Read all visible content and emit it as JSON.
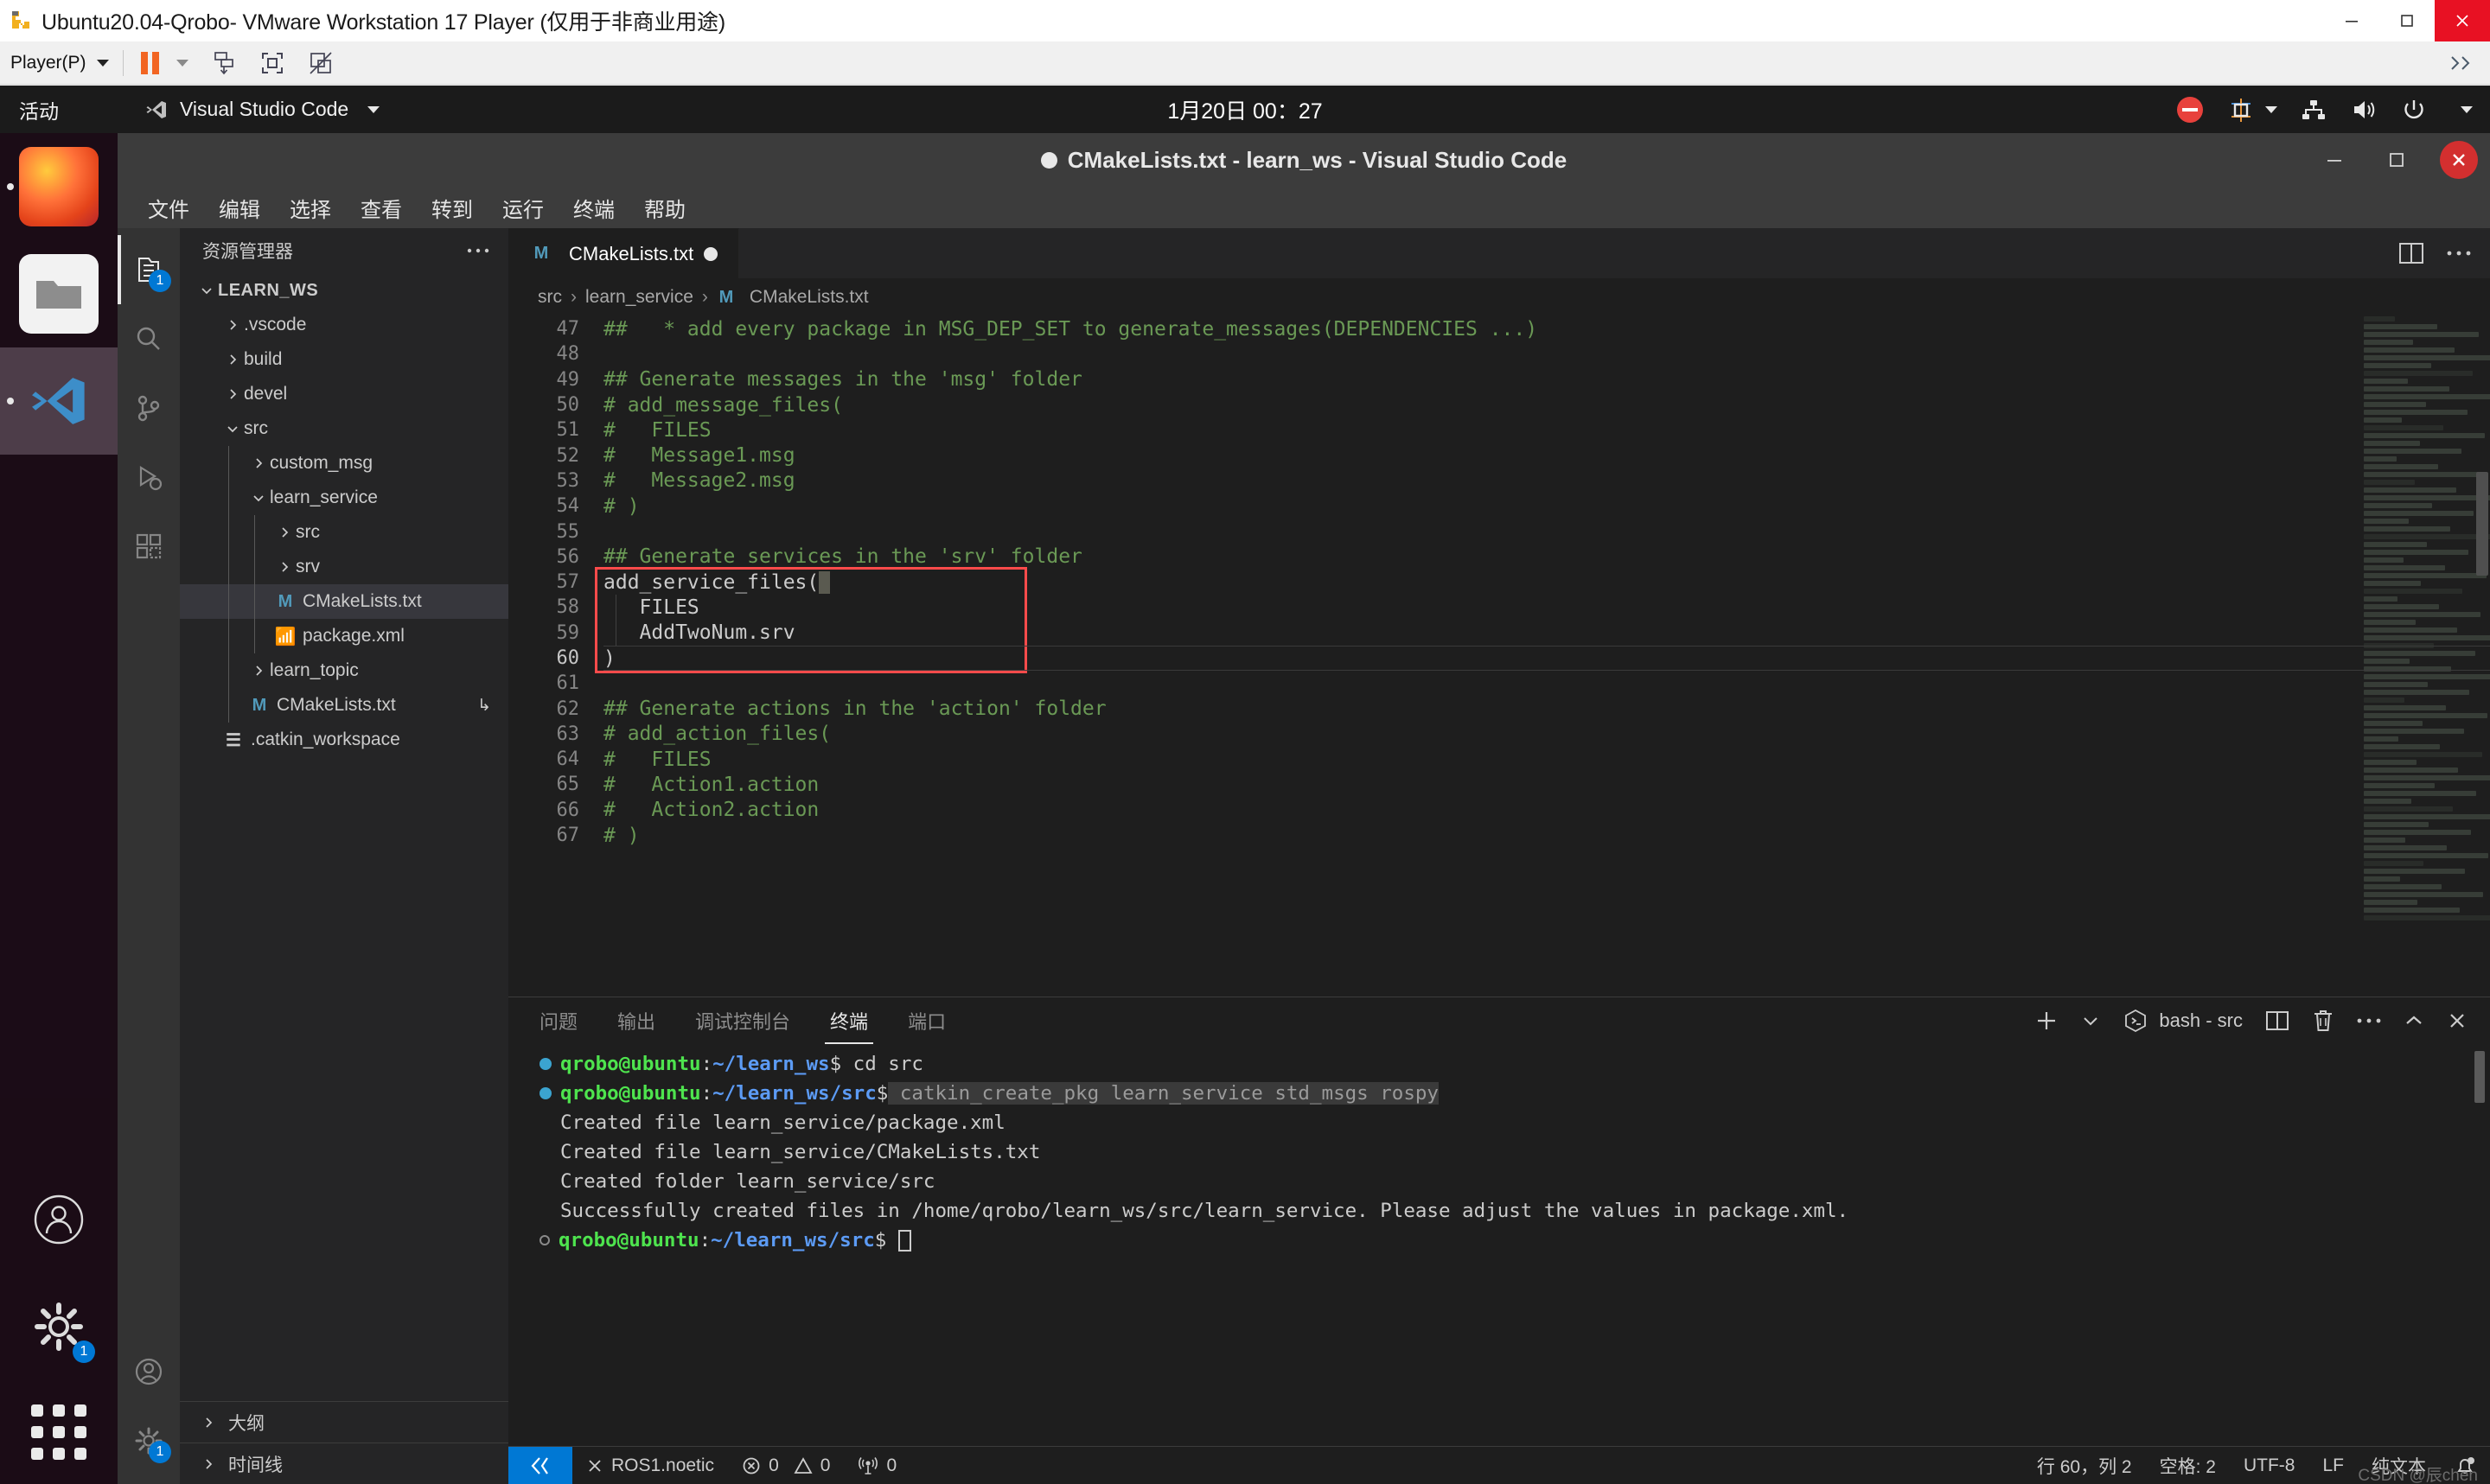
{
  "vmware": {
    "title": "Ubuntu20.04-Qrobo- VMware Workstation 17 Player (仅用于非商业用途)",
    "logo_icon": "vmware-logo-icon",
    "window_controls": [
      {
        "name": "minimize-button",
        "icon": "minimize-icon"
      },
      {
        "name": "restore-button",
        "icon": "restore-icon"
      },
      {
        "name": "close-button",
        "icon": "close-icon"
      }
    ],
    "toolbar": {
      "player_menu_label": "Player(P)",
      "player_menu_accesskey": "P",
      "buttons": [
        {
          "name": "pause-button",
          "icon": "pause-icon"
        },
        {
          "name": "pause-dropdown",
          "icon": "chevron-down-icon"
        },
        {
          "name": "send-ctrl-alt-del-button",
          "icon": "send-key-icon"
        },
        {
          "name": "fullscreen-button",
          "icon": "fullscreen-icon"
        },
        {
          "name": "unity-mode-button",
          "icon": "unity-disabled-icon"
        }
      ],
      "expand_icon": "chevrons-collapse-icon"
    }
  },
  "gnome": {
    "activities_label": "活动",
    "app_menu_label": "Visual Studio Code",
    "app_menu_icon": "vscode-icon",
    "clock": "1月20日 00：27",
    "tray": [
      {
        "name": "do-not-disturb-icon",
        "icon": "no-entry-icon",
        "color": "#e8413c"
      },
      {
        "name": "input-method-icon",
        "label": "中"
      },
      {
        "name": "input-method-chevron-icon",
        "icon": "chevron-down-icon"
      },
      {
        "name": "network-icon",
        "icon": "network-icon"
      },
      {
        "name": "volume-icon",
        "icon": "speaker-icon"
      },
      {
        "name": "power-icon",
        "icon": "power-icon"
      },
      {
        "name": "system-menu-chevron-icon",
        "icon": "chevron-down-icon"
      }
    ],
    "dock": [
      {
        "name": "dock-item-firefox",
        "icon": "firefox-icon",
        "running": true
      },
      {
        "name": "dock-item-files",
        "icon": "files-icon",
        "running": false
      },
      {
        "name": "dock-item-vscode",
        "icon": "vscode-icon",
        "running": true,
        "active": true
      },
      {
        "name": "dock-item-user",
        "icon": "user-account-icon",
        "running": false
      },
      {
        "name": "dock-item-settings",
        "icon": "gear-icon",
        "running": false,
        "badge": "1"
      }
    ],
    "show_apps_label": "show-applications"
  },
  "vscode": {
    "title": "CMakeLists.txt - learn_ws - Visual Studio Code",
    "dirty": true,
    "window_controls": [
      {
        "name": "minimize-button",
        "icon": "minimize-icon"
      },
      {
        "name": "maximize-button",
        "icon": "maximize-icon"
      },
      {
        "name": "close-button",
        "icon": "close-icon"
      }
    ],
    "menubar": [
      "文件",
      "编辑",
      "选择",
      "查看",
      "转到",
      "运行",
      "终端",
      "帮助"
    ],
    "activitybar": [
      {
        "name": "activity-explorer",
        "icon": "files-explorer-icon",
        "active": true,
        "badge": "1"
      },
      {
        "name": "activity-search",
        "icon": "search-icon",
        "active": false
      },
      {
        "name": "activity-source-control",
        "icon": "source-control-icon",
        "active": false
      },
      {
        "name": "activity-run-debug",
        "icon": "run-debug-icon",
        "active": false
      },
      {
        "name": "activity-extensions",
        "icon": "extensions-icon",
        "active": false
      },
      {
        "name": "activity-accounts",
        "icon": "account-icon",
        "active": false
      },
      {
        "name": "activity-manage",
        "icon": "gear-icon",
        "active": false,
        "badge": "1"
      }
    ],
    "sidebar": {
      "title": "资源管理器",
      "more_actions_icon": "ellipsis-icon",
      "root": "LEARN_WS",
      "tree": [
        {
          "label": ".vscode",
          "depth": 1,
          "type": "folder",
          "expanded": false
        },
        {
          "label": "build",
          "depth": 1,
          "type": "folder",
          "expanded": false
        },
        {
          "label": "devel",
          "depth": 1,
          "type": "folder",
          "expanded": false
        },
        {
          "label": "src",
          "depth": 1,
          "type": "folder",
          "expanded": true
        },
        {
          "label": "custom_msg",
          "depth": 2,
          "type": "folder",
          "expanded": false
        },
        {
          "label": "learn_service",
          "depth": 2,
          "type": "folder",
          "expanded": true
        },
        {
          "label": "src",
          "depth": 3,
          "type": "folder",
          "expanded": false
        },
        {
          "label": "srv",
          "depth": 3,
          "type": "folder",
          "expanded": false
        },
        {
          "label": "CMakeLists.txt",
          "depth": 3,
          "type": "file",
          "icon": "cmake-file-icon",
          "selected": true
        },
        {
          "label": "package.xml",
          "depth": 3,
          "type": "file",
          "icon": "xml-file-icon"
        },
        {
          "label": "learn_topic",
          "depth": 2,
          "type": "folder",
          "expanded": false
        },
        {
          "label": "CMakeLists.txt",
          "depth": 2,
          "type": "file",
          "icon": "cmake-file-icon",
          "trailing": "symlink-icon"
        },
        {
          "label": ".catkin_workspace",
          "depth": 1,
          "type": "file",
          "icon": "text-file-icon"
        }
      ],
      "panels": [
        {
          "label": "大纲",
          "name": "sidebar-panel-outline"
        },
        {
          "label": "时间线",
          "name": "sidebar-panel-timeline"
        }
      ]
    },
    "tabs": [
      {
        "label": "CMakeLists.txt",
        "icon": "cmake-file-icon",
        "dirty": true,
        "active": true
      }
    ],
    "tab_actions": [
      {
        "name": "split-editor-button",
        "icon": "split-editor-icon"
      },
      {
        "name": "more-actions-button",
        "icon": "ellipsis-icon"
      }
    ],
    "breadcrumb": [
      "src",
      "learn_service",
      "CMakeLists.txt"
    ],
    "editor": {
      "first_line_number": 47,
      "lines": [
        {
          "n": 47,
          "text": "##   * add every package in MSG_DEP_SET to generate_messages(DEPENDENCIES ...)",
          "kind": "comment"
        },
        {
          "n": 48,
          "text": "",
          "kind": "comment"
        },
        {
          "n": 49,
          "text": "## Generate messages in the 'msg' folder",
          "kind": "comment"
        },
        {
          "n": 50,
          "text": "# add_message_files(",
          "kind": "comment"
        },
        {
          "n": 51,
          "text": "#   FILES",
          "kind": "comment"
        },
        {
          "n": 52,
          "text": "#   Message1.msg",
          "kind": "comment"
        },
        {
          "n": 53,
          "text": "#   Message2.msg",
          "kind": "comment"
        },
        {
          "n": 54,
          "text": "# )",
          "kind": "comment"
        },
        {
          "n": 55,
          "text": "",
          "kind": "comment"
        },
        {
          "n": 56,
          "text": "## Generate services in the 'srv' folder",
          "kind": "comment"
        },
        {
          "n": 57,
          "text": "add_service_files(",
          "kind": "code"
        },
        {
          "n": 58,
          "text": "   FILES",
          "kind": "code"
        },
        {
          "n": 59,
          "text": "   AddTwoNum.srv",
          "kind": "code"
        },
        {
          "n": 60,
          "text": ")",
          "kind": "code",
          "current": true
        },
        {
          "n": 61,
          "text": "",
          "kind": "comment"
        },
        {
          "n": 62,
          "text": "## Generate actions in the 'action' folder",
          "kind": "comment"
        },
        {
          "n": 63,
          "text": "# add_action_files(",
          "kind": "comment"
        },
        {
          "n": 64,
          "text": "#   FILES",
          "kind": "comment"
        },
        {
          "n": 65,
          "text": "#   Action1.action",
          "kind": "comment"
        },
        {
          "n": 66,
          "text": "#   Action2.action",
          "kind": "comment"
        },
        {
          "n": 67,
          "text": "# )",
          "kind": "comment"
        }
      ],
      "highlight_box": {
        "from_line": 57,
        "to_line": 60,
        "color": "#ff4b4b"
      }
    },
    "panel": {
      "tabs": [
        {
          "label": "问题",
          "active": false
        },
        {
          "label": "输出",
          "active": false
        },
        {
          "label": "调试控制台",
          "active": false
        },
        {
          "label": "终端",
          "active": true
        },
        {
          "label": "端口",
          "active": false
        }
      ],
      "terminal_name": "bash - src",
      "terminal_icon": "terminal-bash-icon",
      "actions": [
        {
          "name": "new-terminal-button",
          "icon": "plus-icon"
        },
        {
          "name": "new-terminal-dropdown",
          "icon": "chevron-down-icon"
        },
        {
          "name": "split-terminal-button",
          "icon": "split-icon"
        },
        {
          "name": "kill-terminal-button",
          "icon": "trash-icon"
        },
        {
          "name": "panel-more-actions-button",
          "icon": "ellipsis-icon"
        },
        {
          "name": "maximize-panel-button",
          "icon": "chevron-up-icon"
        },
        {
          "name": "close-panel-button",
          "icon": "close-icon"
        }
      ],
      "lines": [
        {
          "type": "prompt",
          "marker": "ok",
          "user": "qrobo@ubuntu",
          "path": "~/learn_ws",
          "cmd": " cd src"
        },
        {
          "type": "prompt",
          "marker": "ok",
          "user": "qrobo@ubuntu",
          "path": "~/learn_ws/src",
          "cmd": " catkin_create_pkg learn_service std_msgs rospy",
          "cmd_highlight": true
        },
        {
          "type": "output",
          "text": "Created file learn_service/package.xml"
        },
        {
          "type": "output",
          "text": "Created file learn_service/CMakeLists.txt"
        },
        {
          "type": "output",
          "text": "Created folder learn_service/src"
        },
        {
          "type": "output",
          "text": "Successfully created files in /home/qrobo/learn_ws/src/learn_service. Please adjust the values in package.xml."
        },
        {
          "type": "prompt",
          "marker": "hollow",
          "user": "qrobo@ubuntu",
          "path": "~/learn_ws/src",
          "cmd": " ",
          "cursor": true
        }
      ]
    },
    "statusbar": {
      "remote_icon": "remote-window-icon",
      "left": [
        {
          "name": "status-ros-distro",
          "icon": "close-icon",
          "label": "ROS1.noetic"
        },
        {
          "name": "status-errors",
          "icon": "error-icon",
          "label": "0"
        },
        {
          "name": "status-warnings",
          "icon": "warning-icon",
          "label": "0"
        },
        {
          "name": "status-radio-towers",
          "icon": "radio-tower-icon",
          "label": "0"
        }
      ],
      "right": [
        {
          "name": "status-cursor-position",
          "label": "行 60，列 2"
        },
        {
          "name": "status-indentation",
          "label": "空格: 2"
        },
        {
          "name": "status-encoding",
          "label": "UTF-8"
        },
        {
          "name": "status-eol",
          "label": "LF"
        },
        {
          "name": "status-language-mode",
          "label": "纯文本"
        },
        {
          "name": "status-notifications",
          "icon": "bell-dot-icon",
          "label": ""
        }
      ]
    }
  },
  "watermark": "CSDN @辰chen"
}
